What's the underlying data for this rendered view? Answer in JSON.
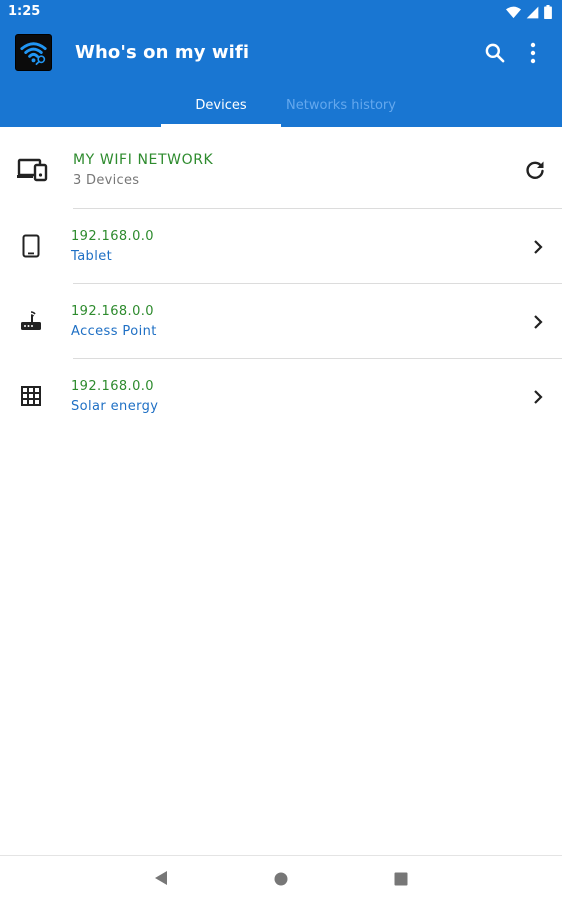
{
  "status_bar": {
    "time": "1:25",
    "icons": [
      "wifi-icon",
      "cell-signal-icon",
      "battery-icon"
    ]
  },
  "app_bar": {
    "title": "Who's on my wifi",
    "app_icon": "wifi-search-app-icon",
    "actions": [
      "search-icon",
      "more-vert-icon"
    ],
    "color": "#1976d2"
  },
  "tabs": [
    {
      "label": "Devices",
      "selected": true
    },
    {
      "label": "Networks history",
      "selected": false
    }
  ],
  "network": {
    "name": "MY WIFI NETWORK",
    "device_count": "3 Devices",
    "icon": "devices-icon",
    "action_icon": "refresh-icon"
  },
  "devices": [
    {
      "ip": "192.168.0.0",
      "type": "Tablet",
      "icon": "tablet-icon"
    },
    {
      "ip": "192.168.0.0",
      "type": "Access Point",
      "icon": "router-icon"
    },
    {
      "ip": "192.168.0.0",
      "type": "Solar energy",
      "icon": "solar-panel-icon"
    }
  ],
  "colors": {
    "primary": "#1976d2",
    "ip_text": "#2e8b2e",
    "type_text": "#1e6fc4",
    "inactive_tab": "#64a8ee"
  },
  "nav_bar": [
    "back-icon",
    "home-icon",
    "recents-icon"
  ]
}
